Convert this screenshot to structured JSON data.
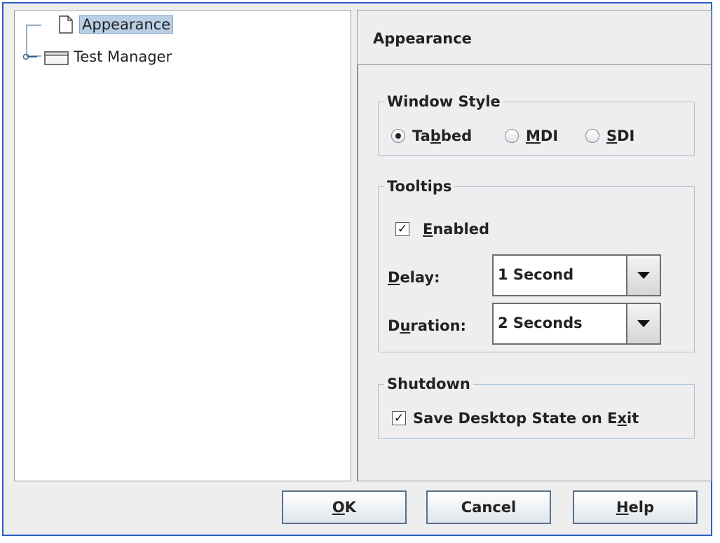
{
  "tree": {
    "items": [
      {
        "label": "Appearance",
        "icon": "page-icon",
        "selected": true
      },
      {
        "label": "Test Manager",
        "icon": "folder-icon",
        "selected": false
      }
    ]
  },
  "panel": {
    "title": "Appearance"
  },
  "window_style": {
    "legend": "Window Style",
    "options": [
      {
        "pre": "Ta",
        "mn": "b",
        "post": "bed",
        "selected": true
      },
      {
        "pre": "",
        "mn": "M",
        "post": "DI",
        "selected": false
      },
      {
        "pre": "",
        "mn": "S",
        "post": "DI",
        "selected": false
      }
    ]
  },
  "tooltips": {
    "legend": "Tooltips",
    "enabled": {
      "pre": "",
      "mn": "E",
      "post": "nabled",
      "checked": true
    },
    "delay": {
      "pre": "",
      "mn": "D",
      "post": "elay:",
      "value": "1 Second"
    },
    "duration": {
      "pre": "D",
      "mn": "u",
      "post": "ration:",
      "value": "2 Seconds"
    }
  },
  "shutdown": {
    "legend": "Shutdown",
    "save_state": {
      "pre": "Save Desktop State on E",
      "mn": "x",
      "post": "it",
      "checked": true
    }
  },
  "buttons": {
    "ok": {
      "pre": "",
      "mn": "O",
      "post": "K"
    },
    "cancel": {
      "pre": "Cancel",
      "mn": "",
      "post": ""
    },
    "help": {
      "pre": "",
      "mn": "H",
      "post": "elp"
    }
  },
  "colors": {
    "frame_border": "#2f5fc7",
    "selection_bg": "#b8cfe5",
    "group_border": "#a8c0d8"
  }
}
